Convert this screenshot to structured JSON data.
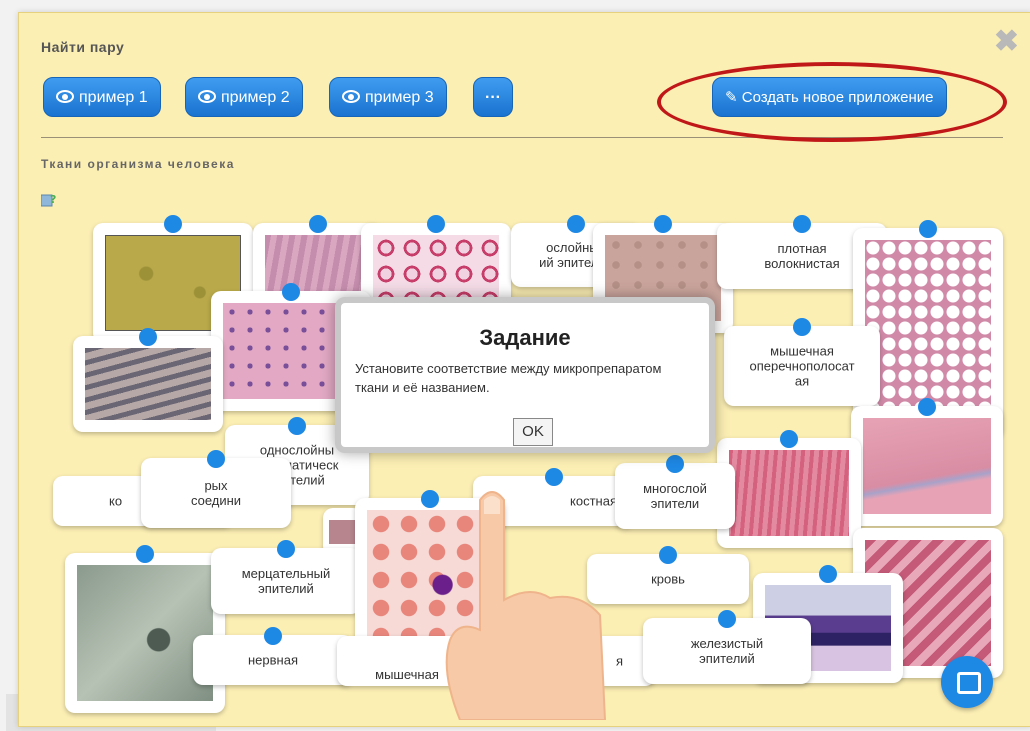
{
  "app": {
    "title": "Найти пару",
    "subtitle": "Ткани организма человека"
  },
  "toolbar": {
    "examples": [
      "пример 1",
      "пример 2",
      "пример 3"
    ],
    "more_label": "···",
    "create_label": "Создать новое приложение"
  },
  "cards": {
    "labels": {
      "c1": "ослойный\nий эпителий",
      "c2": "плотная\nволокнистая",
      "c3": "мышечная\nоперечнополосат\nая",
      "c4": "однослойны\nпризматическ\nэпителий",
      "c5": "рых\nсоедини",
      "c6": "ко",
      "c7": "костная",
      "c8": "многослой\nэпители",
      "c9": "мерцательный\nэпителий",
      "c10": "кровь",
      "c11": "железистый\nэпителий",
      "c12": "нервная",
      "c13": "мышечная",
      "c14": "я"
    }
  },
  "modal": {
    "title": "Задание",
    "text": "Установите соответствие между микропрепаратом ткани и её названием.",
    "ok_label": "OK"
  },
  "colors": {
    "accent": "#1e88e5",
    "panel": "#fcefb4",
    "annotation": "#c01818"
  }
}
